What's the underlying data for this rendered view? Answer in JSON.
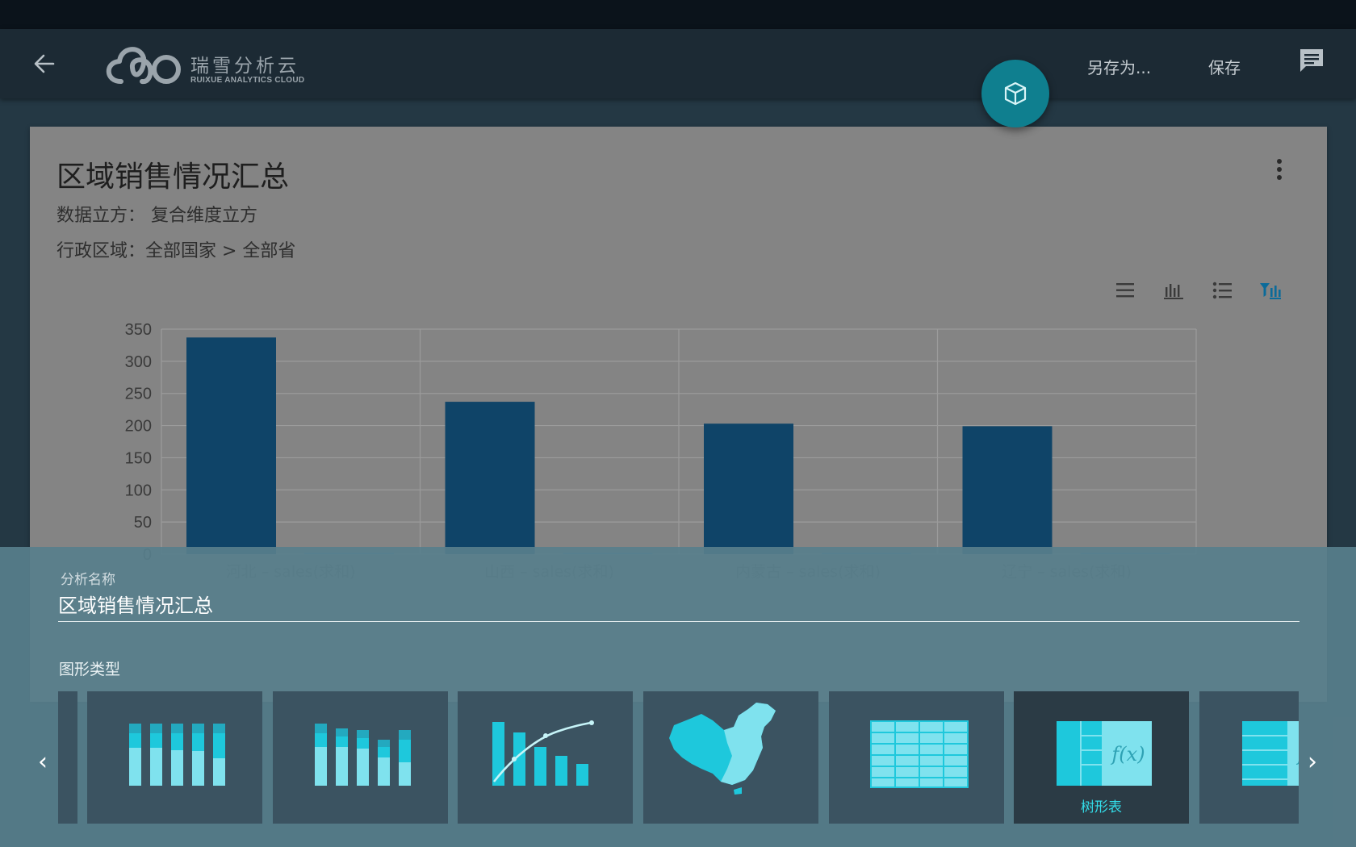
{
  "header": {
    "logo_cn": "瑞雪分析云",
    "logo_en": "RUIXUE ANALYTICS CLOUD",
    "save_as_label": "另存为...",
    "save_label": "保存"
  },
  "card": {
    "title": "区域销售情况汇总",
    "cube_line": "数据立方：  复合维度立方",
    "region_line": "行政区域：全部国家 > 全部省"
  },
  "view_toggles": [
    "list-view",
    "bar-view",
    "detail-list-view",
    "filter-chart-view"
  ],
  "chart_data": {
    "type": "bar",
    "categories": [
      "河北 – sales(求和)",
      "山西 – sales(求和)",
      "内蒙古 – sales(求和)",
      "辽宁 – sales(求和)"
    ],
    "series": [
      {
        "values": [
          337,
          237,
          203,
          199
        ],
        "color": "#0f4468"
      },
      {
        "values": [
          2,
          2,
          2,
          2
        ],
        "color": "#3f7ea2"
      }
    ],
    "yticks": [
      0,
      50,
      100,
      150,
      200,
      250,
      300,
      350
    ],
    "ylim": [
      0,
      350
    ],
    "grid": true,
    "xlabel": "",
    "ylabel": ""
  },
  "panel": {
    "name_label": "分析名称",
    "name_value": "区域销售情况汇总",
    "chart_type_label": "图形类型",
    "prev_arrow": "‹",
    "next_arrow": "›",
    "chart_types": [
      {
        "name": "stacked-bar-100"
      },
      {
        "name": "stacked-bar"
      },
      {
        "name": "pareto"
      },
      {
        "name": "china-map"
      },
      {
        "name": "table"
      },
      {
        "name": "tree-table",
        "label": "树形表",
        "selected": true
      },
      {
        "name": "tree-table-2"
      }
    ]
  },
  "colors": {
    "accent": "#0f7f8f",
    "bar": "#0f4468",
    "tile_icon": "#1ec8dc",
    "tile_icon_light": "#7fe2ee",
    "selected_label": "#33ddea"
  }
}
